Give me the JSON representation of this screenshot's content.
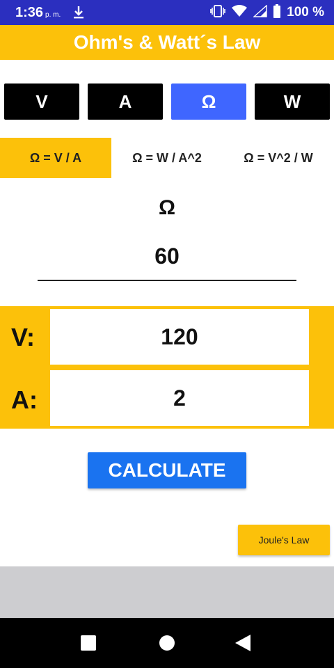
{
  "status_bar": {
    "time": "1:36",
    "ampm": "p. m.",
    "battery": "100 %",
    "icons": [
      "download-icon",
      "vibrate-icon",
      "wifi-icon",
      "signal-icon",
      "battery-icon"
    ]
  },
  "app": {
    "title": "Ohm's & Watt´s Law",
    "colors": {
      "accent": "#fcc10a",
      "active_mode": "#3f66ff",
      "calculate": "#1a73f0"
    }
  },
  "modes": [
    {
      "label": "V",
      "active": false
    },
    {
      "label": "A",
      "active": false
    },
    {
      "label": "Ω",
      "active": true
    },
    {
      "label": "W",
      "active": false
    }
  ],
  "formulas": [
    {
      "label": "Ω = V / A",
      "active": true
    },
    {
      "label": "Ω = W / A^2",
      "active": false
    },
    {
      "label": "Ω = V^2 / W",
      "active": false
    }
  ],
  "result": {
    "symbol": "Ω",
    "value": "60"
  },
  "inputs": [
    {
      "label": "V:",
      "value": "120"
    },
    {
      "label": "A:",
      "value": "2"
    }
  ],
  "buttons": {
    "calculate": "CALCULATE",
    "joule": "Joule's Law"
  },
  "nav": [
    "recents-icon",
    "home-icon",
    "back-icon"
  ]
}
